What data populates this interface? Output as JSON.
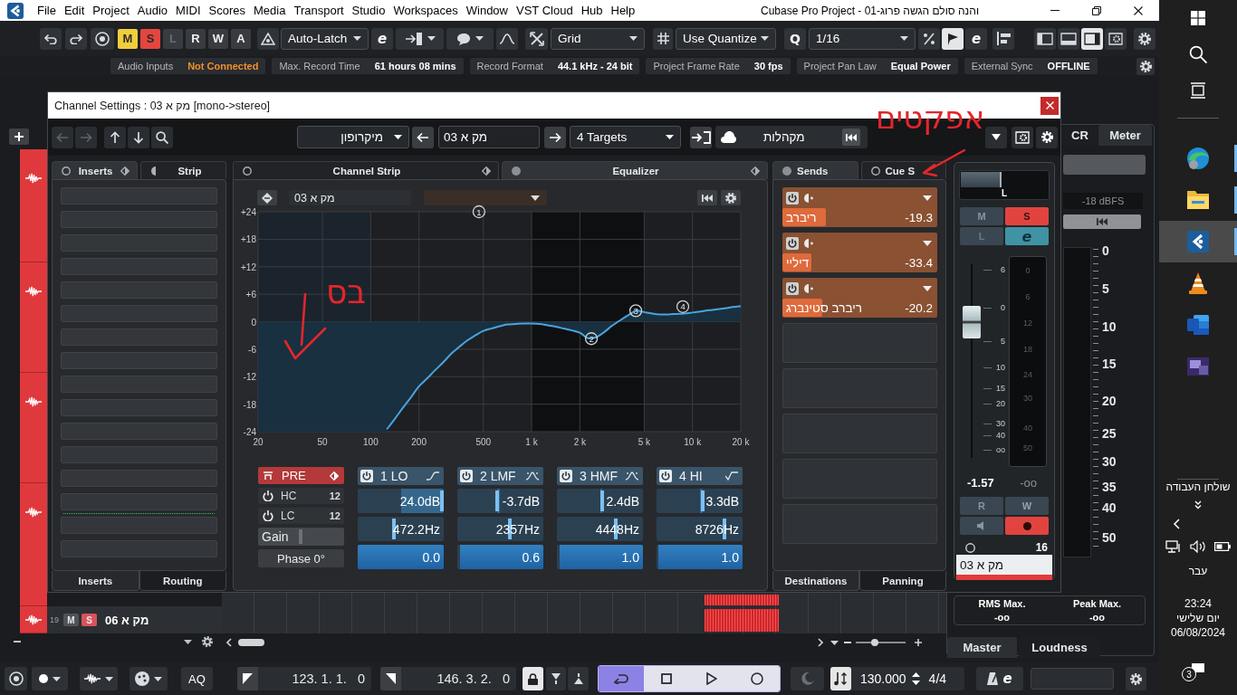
{
  "menu_bar": {
    "menus": [
      "File",
      "Edit",
      "Project",
      "Audio",
      "MIDI",
      "Scores",
      "Media",
      "Transport",
      "Studio",
      "Workspaces",
      "Window",
      "VST Cloud",
      "Hub",
      "Help"
    ],
    "title": "Cubase Pro Project - 01-והנה סולם הגשה פרוג"
  },
  "toolbar": {
    "mode_buttons": [
      {
        "label": "M",
        "kind": "mute",
        "on": true,
        "disabled": false
      },
      {
        "label": "S",
        "kind": "solo",
        "on": true,
        "disabled": false
      },
      {
        "label": "L",
        "kind": "listen",
        "on": false,
        "disabled": true
      },
      {
        "label": "R",
        "kind": "read",
        "on": false,
        "disabled": false
      },
      {
        "label": "W",
        "kind": "write",
        "on": false,
        "disabled": false
      },
      {
        "label": "A",
        "kind": "all",
        "on": false,
        "disabled": false
      }
    ],
    "automation_mode": "Auto-Latch",
    "automation_edit": "e",
    "snap_type": "Grid",
    "quantize_mode": "Use Quantize",
    "quantize_label": "Q",
    "quantize_value": "1/16",
    "quantize_tools": [
      {
        "kind": "swing",
        "on": false
      },
      {
        "kind": "iterative",
        "on": true
      }
    ],
    "quantize_edit": "e",
    "zones": [
      {
        "kind": "left",
        "on": false
      },
      {
        "kind": "lower",
        "on": false
      },
      {
        "kind": "right",
        "on": true
      }
    ]
  },
  "status_line": {
    "items": [
      {
        "label": "Audio Inputs",
        "value": "Not Connected",
        "kind": "warning"
      },
      {
        "label": "Max. Record Time",
        "value": "61 hours 08 mins",
        "kind": "normal"
      },
      {
        "label": "Record Format",
        "value": "44.1 kHz - 24 bit",
        "kind": "normal"
      },
      {
        "label": "Project Frame Rate",
        "value": "30 fps",
        "kind": "normal"
      },
      {
        "label": "Project Pan Law",
        "value": "Equal Power",
        "kind": "normal"
      },
      {
        "label": "External Sync",
        "value": "OFFLINE",
        "kind": "normal"
      }
    ]
  },
  "project": {
    "track": {
      "number": "19",
      "name": "מק א 06",
      "buttons": [
        {
          "label": "M",
          "kind": "mute",
          "on": false
        },
        {
          "label": "S",
          "kind": "solo",
          "on": true
        }
      ]
    },
    "zoom": {
      "level": 0.36
    }
  },
  "meter_panel": {
    "tabs": [
      {
        "label": "CR",
        "selected": false
      },
      {
        "label": "Meter",
        "selected": true
      }
    ],
    "reference": "-18 dBFS",
    "scale": [
      "0",
      "5",
      "10",
      "15",
      "20",
      "25",
      "30",
      "35",
      "40",
      "50"
    ],
    "stats": [
      {
        "label": "RMS Max.",
        "value": "-oo"
      },
      {
        "label": "Peak Max.",
        "value": "-oo"
      }
    ],
    "bottom_tabs": [
      {
        "label": "Master",
        "selected": true
      },
      {
        "label": "Loudness",
        "selected": false
      }
    ]
  },
  "channel_settings": {
    "title": "Channel Settings : מק א 03 [mono->stereo]",
    "toolbar": {
      "input": "מיקרופון",
      "channel_name": "מק א 03",
      "targets": "4 Targets",
      "output": "מקהלות"
    },
    "inserts": {
      "tabs": [
        {
          "label": "Inserts",
          "selected": true
        },
        {
          "label": "Strip",
          "selected": false
        }
      ],
      "bottom_tabs": [
        {
          "label": "Inserts",
          "selected": true
        },
        {
          "label": "Routing",
          "selected": false
        }
      ]
    },
    "center_tabs": [
      {
        "label": "Channel Strip",
        "selected": false
      },
      {
        "label": "Equalizer",
        "selected": true
      }
    ],
    "equalizer": {
      "channel_name": "מק א 03",
      "annotation": "בס",
      "chart_data": {
        "type": "line",
        "grid": true,
        "categories": [
          "20",
          null,
          null,
          null,
          null,
          null,
          null,
          null,
          "50",
          null,
          null,
          null,
          null,
          null,
          "100",
          null,
          null,
          null,
          null,
          null,
          "200",
          null,
          null,
          null,
          null,
          null,
          null,
          null,
          "500",
          null,
          null,
          null,
          null,
          null,
          "1 k",
          null,
          null,
          null,
          null,
          null,
          "2 k",
          null,
          null,
          null,
          null,
          null,
          null,
          null,
          "5 k",
          null,
          null,
          null,
          null,
          null,
          "10 k",
          null,
          null,
          null,
          null,
          null,
          "20 k"
        ],
        "values": [
          null,
          null,
          null,
          null,
          null,
          null,
          null,
          null,
          null,
          null,
          null,
          null,
          null,
          null,
          null,
          null,
          -23.5,
          -21.2,
          -18.8,
          -16.5,
          -14.1,
          -12.4,
          -10.6,
          -8.9,
          -7.0,
          -5.5,
          -4.1,
          -3.0,
          -2.0,
          -1.5,
          -1.0,
          -0.6,
          -0.5,
          -0.4,
          -0.4,
          -0.5,
          -0.8,
          -1.1,
          -1.5,
          -1.9,
          -2.4,
          -3.6,
          -3.4,
          -2.3,
          -0.9,
          0.3,
          1.4,
          2.4,
          2.1,
          1.8,
          1.6,
          1.6,
          1.7,
          1.8,
          2.0,
          2.2,
          2.5,
          2.7,
          2.9,
          3.2,
          3.4
        ],
        "ylim": [
          -24,
          24
        ],
        "yticks": [
          {
            "value": 24,
            "label": "+24"
          },
          {
            "value": 18,
            "label": "+18"
          },
          {
            "value": 12,
            "label": "+12"
          },
          {
            "value": 6,
            "label": "+6"
          },
          0,
          -6,
          -12,
          -18,
          -24
        ],
        "annotations": [
          "1",
          "2",
          "3",
          "4"
        ]
      },
      "pre": {
        "label": "PRE",
        "on": true,
        "filters": [
          {
            "label": "HC",
            "slope": "12"
          },
          {
            "label": "LC",
            "slope": "12"
          }
        ],
        "gain": {
          "label": "Gain",
          "level": 0.49
        },
        "phase": "Phase 0°"
      },
      "bands": [
        {
          "label": "1 LO",
          "kind": "low_shelf",
          "gain": {
            "value": "24.0dB",
            "level": 1.0
          },
          "frequency": {
            "value": "472.2Hz",
            "level": 0.42
          },
          "q": {
            "value": "0.0",
            "level": 1.0
          }
        },
        {
          "label": "2 LMF",
          "kind": "peak",
          "gain": {
            "value": "-3.7dB",
            "level": 0.46
          },
          "frequency": {
            "value": "2357Hz",
            "level": 0.61
          },
          "q": {
            "value": "0.6",
            "level": 0.97
          }
        },
        {
          "label": "3 HMF",
          "kind": "peak",
          "gain": {
            "value": "2.4dB",
            "level": 0.53
          },
          "frequency": {
            "value": "4448Hz",
            "level": 0.69
          },
          "q": {
            "value": "1.0",
            "level": 0.97
          }
        },
        {
          "label": "4 HI",
          "kind": "high_shelf",
          "gain": {
            "value": "3.3dB",
            "level": 0.54
          },
          "frequency": {
            "value": "8726Hz",
            "level": 0.8
          },
          "q": {
            "value": "1.0",
            "level": 0.98
          }
        }
      ]
    },
    "sends": {
      "tabs": [
        {
          "label": "Sends",
          "selected": true
        },
        {
          "label": "Cue S",
          "selected": false
        }
      ],
      "annotation": "אפקטים",
      "slots": [
        {
          "name": "ריברב",
          "value": "-19.3",
          "level": 0.28
        },
        {
          "name": "דיליי",
          "value": "-33.4",
          "level": 0.19
        },
        {
          "name": "ריברב סטינברג",
          "value": "-20.2",
          "level": 0.26
        }
      ],
      "bottom_tabs": [
        {
          "label": "Destinations",
          "selected": true
        },
        {
          "label": "Panning",
          "selected": false
        }
      ]
    },
    "strip": {
      "pan": {
        "label": "L",
        "level": 0.48
      },
      "buttons": [
        {
          "label": "M",
          "kind": "mute",
          "on": false
        },
        {
          "label": "S",
          "kind": "solo",
          "on": true
        },
        {
          "label": "L",
          "kind": "listen",
          "on": false
        },
        {
          "label": "e",
          "kind": "edit",
          "on": true
        }
      ],
      "fader": {
        "level": 0.7,
        "scale": [
          "6",
          "0",
          "5",
          "10",
          "15",
          "20",
          "30",
          "40",
          "oo"
        ]
      },
      "meter_scale": [
        "0",
        "6",
        "12",
        "18",
        "24",
        "30",
        "40",
        "50"
      ],
      "volume": "-1.57",
      "peak": "-oo",
      "io_buttons": [
        {
          "label": "R",
          "kind": "read",
          "on": false
        },
        {
          "label": "W",
          "kind": "write",
          "on": false
        },
        {
          "kind": "monitor",
          "on": false
        },
        {
          "kind": "record",
          "on": true
        }
      ],
      "number": "16",
      "name": "מק א 03"
    }
  },
  "transport": {
    "aq": "AQ",
    "left_locator": "123. 1. 1.   0",
    "right_locator": "146. 3. 2.   0",
    "lock": {
      "on": true
    },
    "controls": [
      {
        "kind": "cycle",
        "on": true
      },
      {
        "kind": "stop",
        "on": false
      },
      {
        "kind": "play",
        "on": false
      },
      {
        "kind": "record",
        "on": false
      }
    ],
    "tempo": "130.000",
    "signature": "4/4",
    "click_edit": "e"
  },
  "taskbar": {
    "apps": [
      {
        "kind": "browser",
        "selected": false,
        "running": true
      },
      {
        "kind": "folder",
        "selected": false,
        "running": true
      },
      {
        "kind": "daw",
        "selected": true,
        "running": true
      },
      {
        "kind": "player",
        "selected": false,
        "running": false
      },
      {
        "kind": "document",
        "selected": false,
        "running": false
      },
      {
        "kind": "viewer",
        "selected": false,
        "running": false
      }
    ],
    "desktop": "שולחן העבודה",
    "language": "עבר",
    "time": "23:24",
    "day": "יום שלישי",
    "date": "06/08/2024",
    "notifications": "3"
  }
}
